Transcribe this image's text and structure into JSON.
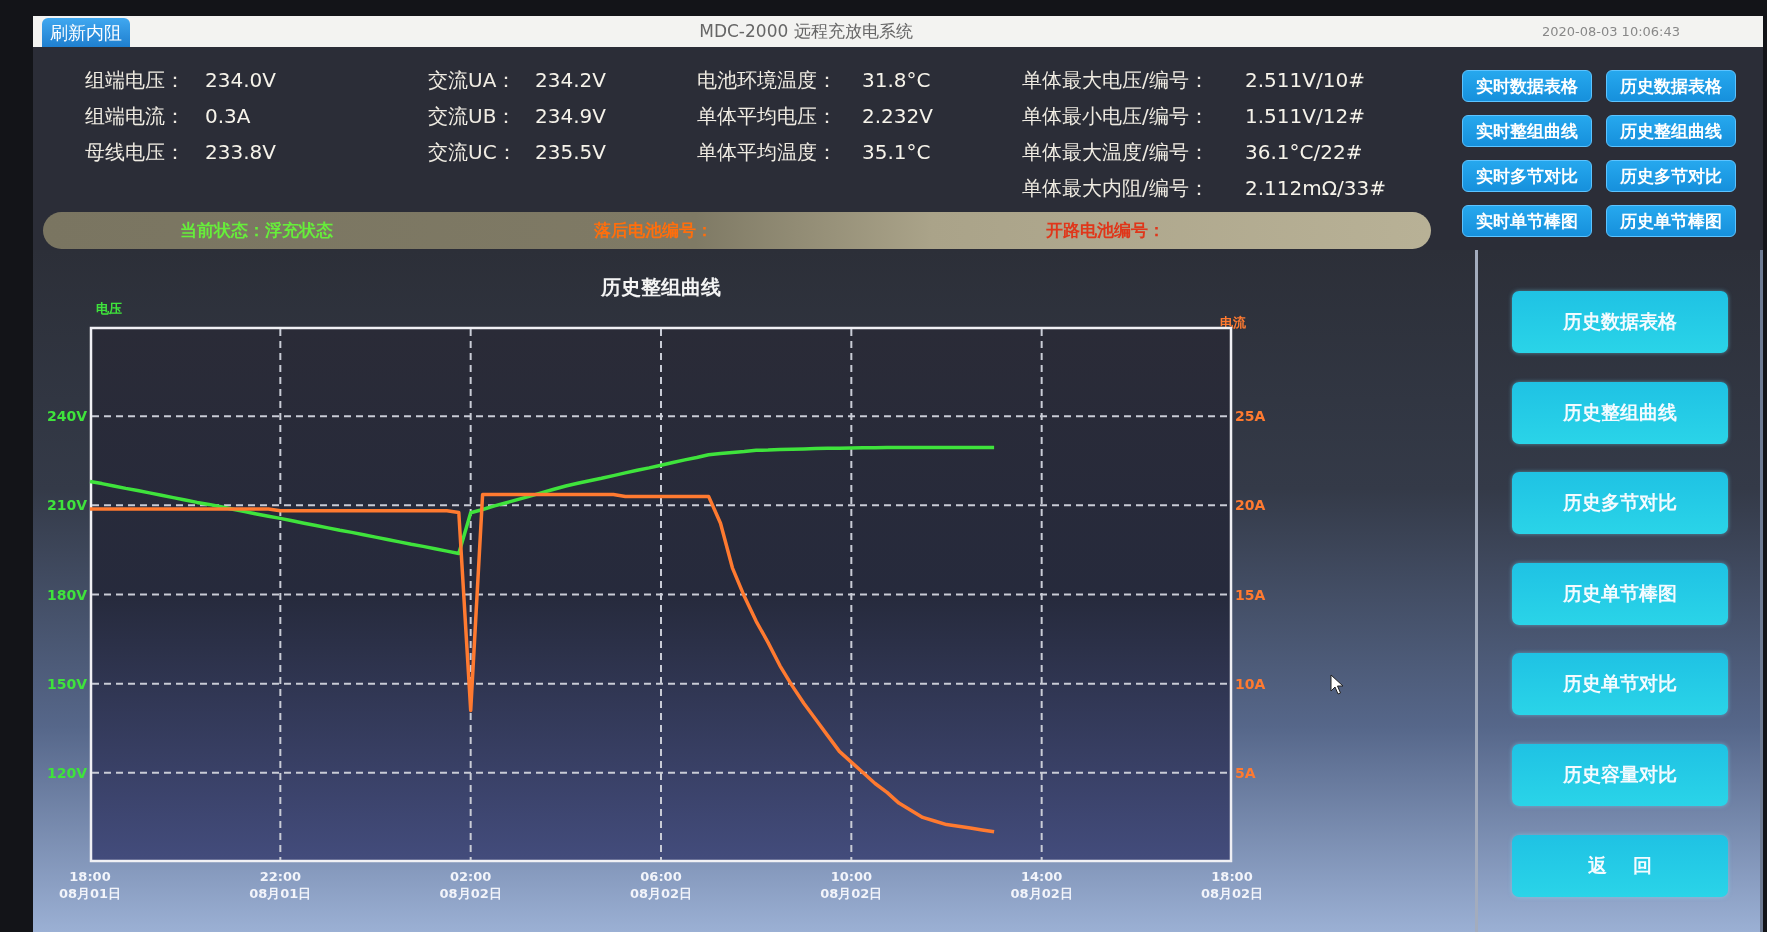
{
  "title_bar": {
    "button": "刷新内阻",
    "title": "MDC-2000 远程充放电系统",
    "datetime": "2020-08-03 10:06:43"
  },
  "readings": [
    {
      "items": [
        {
          "label": "组端电压：",
          "value": "234.0V"
        },
        {
          "label": "组端电流：",
          "value": "0.3A"
        },
        {
          "label": "母线电压：",
          "value": "233.8V"
        }
      ]
    },
    {
      "items": [
        {
          "label": "交流UA：",
          "value": "234.2V"
        },
        {
          "label": "交流UB：",
          "value": "234.9V"
        },
        {
          "label": "交流UC：",
          "value": "235.5V"
        }
      ]
    },
    {
      "items": [
        {
          "label": "电池环境温度：",
          "value": "31.8°C"
        },
        {
          "label": "单体平均电压：",
          "value": "2.232V"
        },
        {
          "label": "单体平均温度：",
          "value": "35.1°C"
        }
      ]
    },
    {
      "items": [
        {
          "label": "单体最大电压/编号：",
          "value": "2.511V/10#"
        },
        {
          "label": "单体最小电压/编号：",
          "value": "1.511V/12#"
        },
        {
          "label": "单体最大温度/编号：",
          "value": "36.1°C/22#"
        },
        {
          "label": "单体最大内阻/编号：",
          "value": "2.112mΩ/33#"
        }
      ]
    }
  ],
  "status_bar": [
    {
      "kind": "current",
      "text": "当前状态：浮充状态"
    },
    {
      "kind": "lagging",
      "text": "落后电池编号："
    },
    {
      "kind": "open",
      "text": "开路电池编号："
    }
  ],
  "nav_buttons": [
    "实时数据表格",
    "历史数据表格",
    "实时整组曲线",
    "历史整组曲线",
    "实时多节对比",
    "历史多节对比",
    "实时单节棒图",
    "历史单节棒图"
  ],
  "history": {
    "chart_data": {
      "type": "line",
      "title": "历史整组曲线",
      "grid": true,
      "categories": [
        "18:00\n08月01日",
        null,
        null,
        null,
        null,
        null,
        null,
        null,
        null,
        null,
        null,
        null,
        null,
        null,
        null,
        null,
        "22:00\n08月01日",
        null,
        null,
        null,
        null,
        null,
        null,
        null,
        null,
        null,
        null,
        null,
        null,
        null,
        null,
        null,
        "02:00\n08月02日",
        null,
        null,
        null,
        null,
        null,
        null,
        null,
        null,
        null,
        null,
        null,
        null,
        null,
        null,
        null,
        "06:00\n08月02日",
        null,
        null,
        null,
        null,
        null,
        null,
        null,
        null,
        null,
        null,
        null,
        null,
        null,
        null,
        null,
        "10:00\n08月02日",
        null,
        null,
        null,
        null,
        null,
        null,
        null,
        null,
        null,
        null,
        null,
        null,
        null,
        null,
        null,
        "14:00\n08月02日",
        null,
        null,
        null,
        null,
        null,
        null,
        null,
        null,
        null,
        null,
        null,
        null,
        null,
        null,
        null,
        "18:00\n08月02日"
      ],
      "ylim": [
        90,
        270
      ],
      "yticks": [
        {
          "value": 120,
          "label": "120V"
        },
        {
          "value": 150,
          "label": "150V"
        },
        {
          "value": 180,
          "label": "180V"
        },
        {
          "value": 210,
          "label": "210V"
        },
        {
          "value": 240,
          "label": "240V"
        }
      ],
      "y2lim": [
        0,
        30
      ],
      "y2ticks": [
        {
          "value": 5,
          "label": "5A"
        },
        {
          "value": 10,
          "label": "10A"
        },
        {
          "value": 15,
          "label": "15A"
        },
        {
          "value": 20,
          "label": "20A"
        },
        {
          "value": 25,
          "label": "25A"
        }
      ],
      "series": [
        {
          "name": "电压",
          "color": "#3fe33c",
          "values": [
            218.0,
            217.3,
            216.5,
            215.7,
            215.0,
            214.2,
            213.4,
            212.6,
            211.8,
            211.0,
            210.3,
            209.5,
            208.7,
            207.9,
            207.1,
            206.3,
            205.6,
            204.8,
            204.0,
            203.2,
            202.4,
            201.6,
            200.9,
            200.1,
            199.3,
            198.5,
            197.7,
            196.9,
            196.2,
            195.4,
            194.6,
            193.8,
            207.5,
            208.6,
            209.8,
            210.9,
            212.0,
            213.1,
            214.3,
            215.4,
            216.5,
            217.4,
            218.3,
            219.1,
            220.0,
            220.9,
            221.8,
            222.6,
            223.5,
            224.4,
            225.3,
            226.1,
            227.0,
            227.4,
            227.8,
            228.1,
            228.5,
            228.6,
            228.8,
            228.9,
            229.0,
            229.1,
            229.2,
            229.2,
            229.3,
            229.4,
            229.4,
            229.5,
            229.5,
            229.5,
            229.5,
            229.5,
            229.5,
            229.5,
            229.5,
            229.5,
            229.5,
            null,
            null,
            null,
            null,
            null,
            null,
            null,
            null,
            null,
            null,
            null,
            null,
            null,
            null,
            null,
            null,
            null,
            null,
            null,
            null
          ]
        },
        {
          "name": "电流",
          "color": "#ff7a30",
          "axis": "y2",
          "values": [
            19.8,
            19.8,
            19.8,
            19.8,
            19.8,
            19.8,
            19.8,
            19.8,
            19.8,
            19.8,
            19.8,
            19.8,
            19.8,
            19.8,
            19.8,
            19.8,
            19.7,
            19.7,
            19.7,
            19.7,
            19.7,
            19.7,
            19.7,
            19.7,
            19.7,
            19.7,
            19.7,
            19.7,
            19.7,
            19.7,
            19.7,
            19.6,
            8.5,
            20.6,
            20.6,
            20.6,
            20.6,
            20.6,
            20.6,
            20.6,
            20.6,
            20.6,
            20.6,
            20.6,
            20.6,
            20.5,
            20.5,
            20.5,
            20.5,
            20.5,
            20.5,
            20.5,
            20.5,
            19.0,
            16.5,
            14.9,
            13.5,
            12.3,
            11.0,
            9.9,
            8.9,
            8.0,
            7.1,
            6.2,
            5.6,
            5.0,
            4.4,
            3.9,
            3.3,
            2.9,
            2.5,
            2.3,
            2.1,
            2.0,
            1.9,
            1.8,
            1.7,
            null,
            null,
            null,
            null,
            null,
            null,
            null,
            null,
            null,
            null,
            null,
            null,
            null,
            null,
            null,
            null,
            null,
            null,
            null,
            null
          ]
        }
      ]
    },
    "buttons": [
      "历史数据表格",
      "历史整组曲线",
      "历史多节对比",
      "历史单节棒图",
      "历史单节对比",
      "历史容量对比",
      "返    回"
    ]
  }
}
